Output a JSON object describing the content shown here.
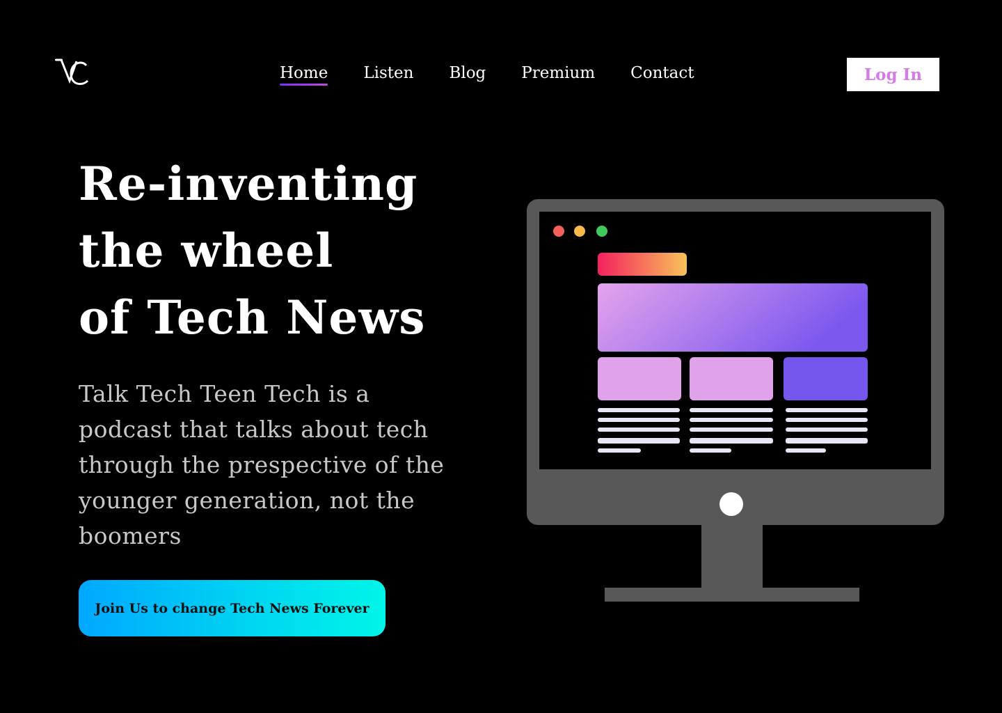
{
  "logo": {
    "text": "VC",
    "icon": "vc-monogram-logo"
  },
  "nav": {
    "items": [
      {
        "label": "Home",
        "active": true
      },
      {
        "label": "Listen",
        "active": false
      },
      {
        "label": "Blog",
        "active": false
      },
      {
        "label": "Premium",
        "active": false
      },
      {
        "label": "Contact",
        "active": false
      }
    ],
    "active_underline_color": "#7b2ff7"
  },
  "login": {
    "label": "Log In",
    "text_color": "#d67ae8"
  },
  "hero": {
    "title_lines": [
      "Re-inventing",
      "the wheel",
      "of Tech News"
    ],
    "description_lines": [
      "Talk Tech Teen Tech is a",
      "podcast that talks about tech",
      "through the prespective of the",
      "younger generation, not the",
      "boomers"
    ],
    "cta_label": "Join Us to change Tech News Forever"
  },
  "illustration": {
    "icon": "desktop-monitor-illustration",
    "colors": {
      "frame": "#585858",
      "dot_red": "#f4615a",
      "dot_yellow": "#f6b94a",
      "dot_green": "#3fc95a",
      "banner_start": "#f4215e",
      "banner_end": "#f9c25a",
      "hero_start": "#e4a4ec",
      "hero_end": "#7b57ee",
      "card_light": "#e1a2ec",
      "card_dark": "#7657ee",
      "text_line": "#e6e6f5"
    }
  }
}
